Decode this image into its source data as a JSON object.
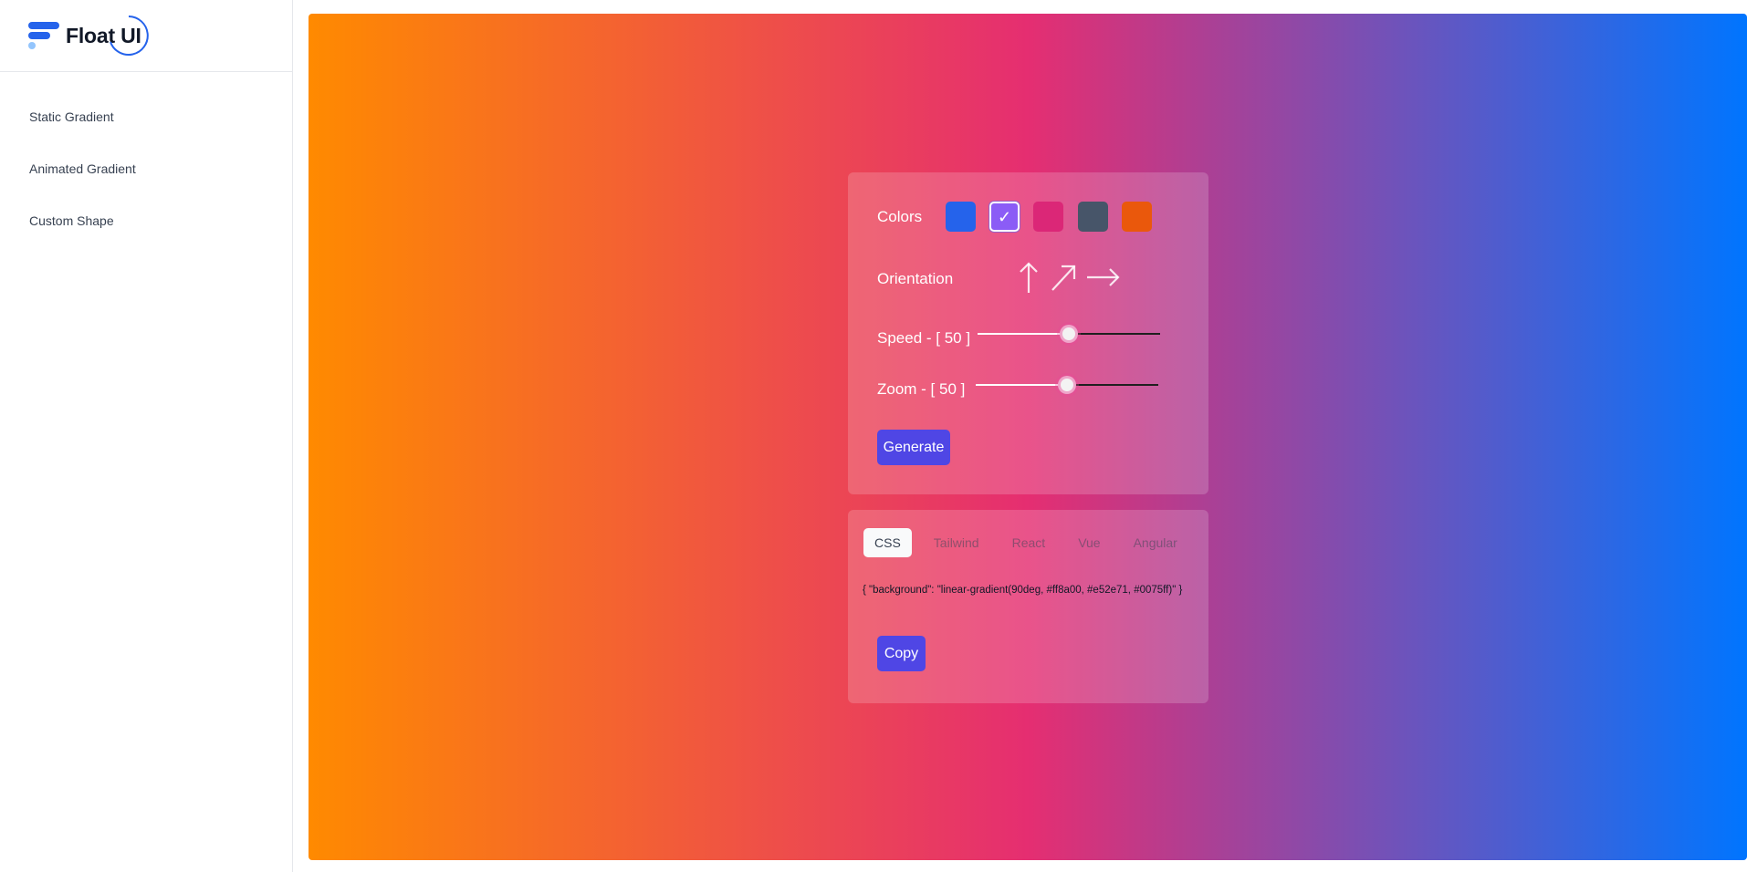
{
  "brand": {
    "name": "Float UI"
  },
  "sidebar": {
    "items": [
      {
        "label": "Static Gradient"
      },
      {
        "label": "Animated Gradient"
      },
      {
        "label": "Custom Shape"
      }
    ]
  },
  "preview": {
    "gradient_colors": [
      "#ff8a00",
      "#e52e71",
      "#0075ff"
    ],
    "angle_deg": 90
  },
  "controls": {
    "colors_label": "Colors",
    "swatches": [
      {
        "color": "#2563eb",
        "selected": false
      },
      {
        "color": "#8b5cf6",
        "selected": true
      },
      {
        "color": "#db2777",
        "selected": false
      },
      {
        "color": "#475569",
        "selected": false
      },
      {
        "color": "#ea580c",
        "selected": false
      }
    ],
    "orientation_label": "Orientation",
    "orientations": [
      "arrow-up-icon",
      "arrow-up-right-icon",
      "arrow-right-icon"
    ],
    "speed": {
      "label": "Speed - [ 50 ]",
      "value": 50,
      "max": 100
    },
    "zoom": {
      "label": "Zoom - [ 50 ]",
      "value": 50,
      "max": 100
    },
    "generate_label": "Generate"
  },
  "code": {
    "tabs": [
      "CSS",
      "Tailwind",
      "React",
      "Vue",
      "Angular"
    ],
    "active_tab": "CSS",
    "snippet": "{ \"background\": \"linear-gradient(90deg, #ff8a00, #e52e71, #0075ff)\" }",
    "copy_label": "Copy"
  },
  "accent": "#4f46e5"
}
